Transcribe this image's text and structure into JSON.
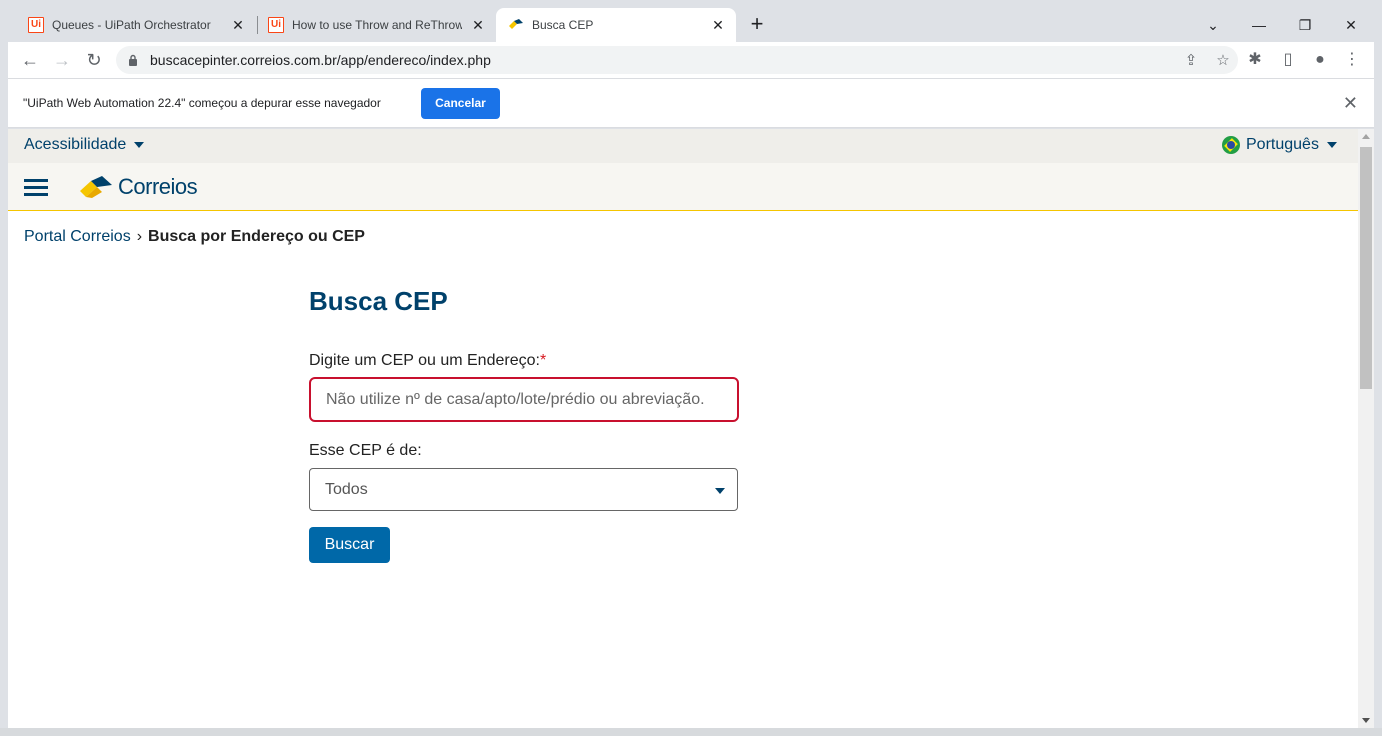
{
  "browser": {
    "tabs": [
      {
        "title": "Queues - UiPath Orchestrator",
        "favicon": "uipath-icon"
      },
      {
        "title": "How to use Throw and ReThrow",
        "favicon": "uipath-icon"
      },
      {
        "title": "Busca CEP",
        "favicon": "correios-icon"
      }
    ],
    "url": "buscacepinter.correios.com.br/app/endereco/index.php",
    "infobar": {
      "message": "\"UiPath Web Automation 22.4\" começou a depurar esse navegador",
      "button": "Cancelar"
    }
  },
  "page": {
    "accessibility": "Acessibilidade",
    "language": "Português",
    "logo_text": "Correios",
    "breadcrumb": {
      "link": "Portal Correios",
      "current": "Busca por Endereço ou CEP"
    },
    "title": "Busca CEP",
    "form": {
      "cep_label": "Digite um CEP ou um Endereço:",
      "required_mark": "*",
      "cep_placeholder": "Não utilize nº de casa/apto/lote/prédio ou abreviação.",
      "type_label": "Esse CEP é de:",
      "type_value": "Todos",
      "submit": "Buscar"
    }
  },
  "colors": {
    "brand_blue": "#00416b",
    "brand_yellow": "#f5c500",
    "error_red": "#c8102e",
    "button_blue": "#0068a8"
  }
}
